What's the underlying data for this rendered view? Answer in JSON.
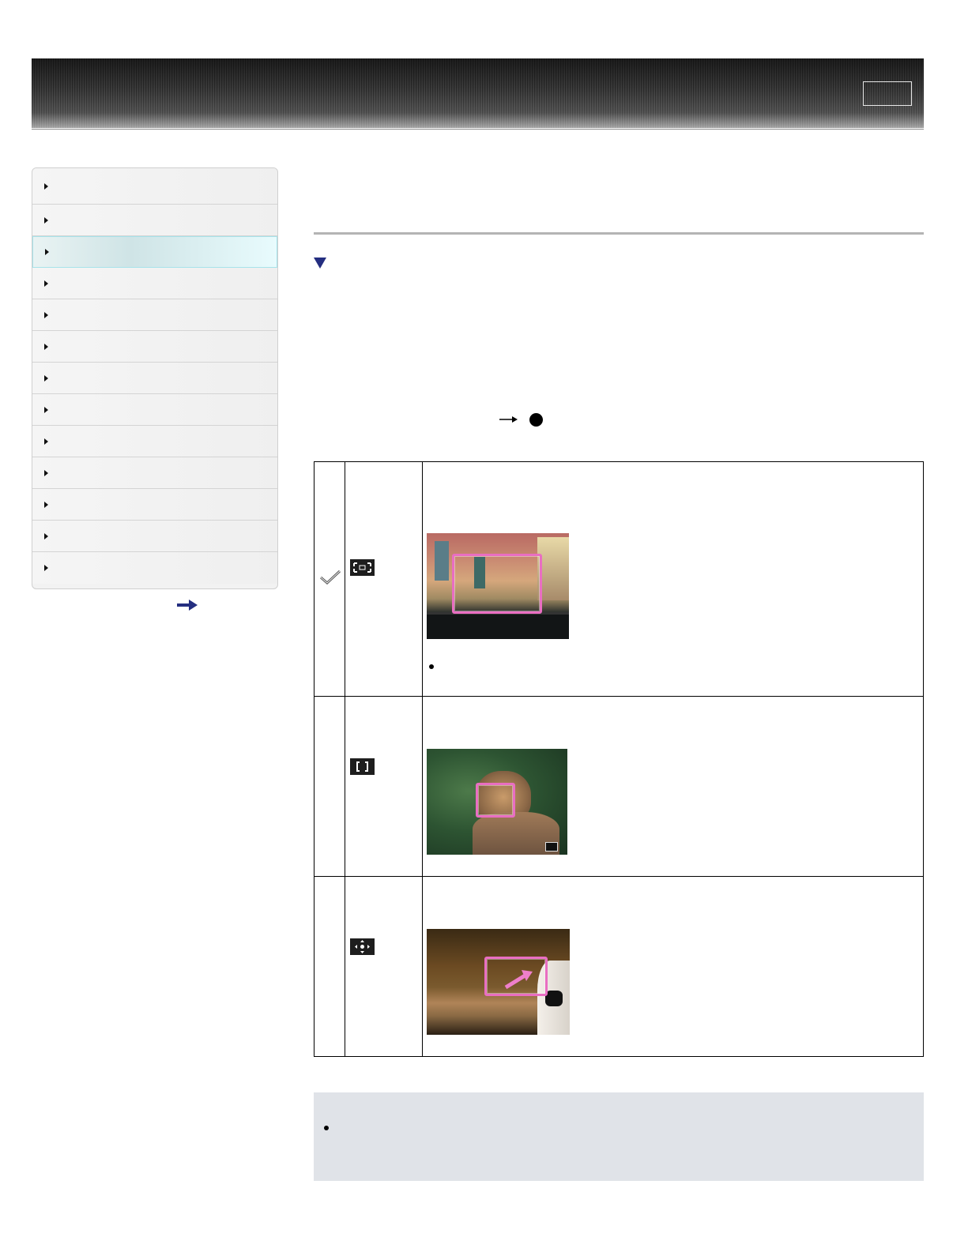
{
  "header": {
    "title": "",
    "top_button_label": ""
  },
  "sidebar": {
    "items": [
      {
        "label": ""
      },
      {
        "label": ""
      },
      {
        "label": "",
        "active": true
      },
      {
        "label": ""
      },
      {
        "label": ""
      },
      {
        "label": ""
      },
      {
        "label": ""
      },
      {
        "label": ""
      },
      {
        "label": ""
      },
      {
        "label": ""
      },
      {
        "label": ""
      },
      {
        "label": ""
      },
      {
        "label": ""
      }
    ],
    "more_link_icon": "arrow-right-icon"
  },
  "main": {
    "title": "",
    "section_toggle_icon": "triangle-down-icon",
    "procedure_icons": [
      "arrow-right-icon",
      "filled-circle-icon"
    ]
  },
  "modes": [
    {
      "selected": true,
      "icon": "wide-focus-area-icon",
      "image": "gondola-canal-photo",
      "has_bullet": true
    },
    {
      "selected": false,
      "icon": "center-focus-area-icon",
      "image": "cat-photo",
      "has_bullet": false
    },
    {
      "selected": false,
      "icon": "flexible-spot-icon",
      "image": "dog-photo",
      "has_bullet": false
    }
  ],
  "colors": {
    "header_dark": "#2b2b2b",
    "active_item": "#cfe4e6",
    "active_border": "#a7e3ea",
    "focus_frame": "#e96ec2",
    "link_blue": "#242e80",
    "note_background": "#e0e3e8"
  }
}
